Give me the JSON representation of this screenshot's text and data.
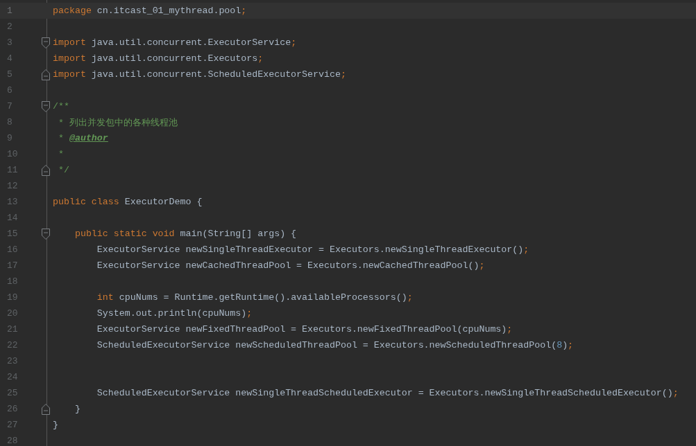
{
  "editor": {
    "lines": [
      {
        "number": "1",
        "current": true,
        "kind": "plain",
        "tokens": [
          {
            "kind": "keyword",
            "text": "package "
          },
          {
            "kind": "plain",
            "text": "cn.itcast_01_mythread.pool"
          },
          {
            "kind": "punct",
            "text": ";"
          }
        ]
      },
      {
        "number": "2",
        "current": false,
        "kind": "plain"
      },
      {
        "number": "3",
        "current": false,
        "kind": "fold_start",
        "tokens": [
          {
            "kind": "keyword",
            "text": "import "
          },
          {
            "kind": "plain",
            "text": "java.util.concurrent.ExecutorService"
          },
          {
            "kind": "punct",
            "text": ";"
          }
        ]
      },
      {
        "number": "4",
        "current": false,
        "kind": "plain",
        "tokens": [
          {
            "kind": "keyword",
            "text": "import "
          },
          {
            "kind": "plain",
            "text": "java.util.concurrent.Executors"
          },
          {
            "kind": "punct",
            "text": ";"
          }
        ]
      },
      {
        "number": "5",
        "current": false,
        "kind": "fold_end",
        "tokens": [
          {
            "kind": "keyword",
            "text": "import "
          },
          {
            "kind": "plain",
            "text": "java.util.concurrent.ScheduledExecutorService"
          },
          {
            "kind": "punct",
            "text": ";"
          }
        ]
      },
      {
        "number": "6",
        "current": false,
        "kind": "plain"
      },
      {
        "number": "7",
        "current": false,
        "kind": "fold_start",
        "tokens": [
          {
            "kind": "comment",
            "text": "/**"
          }
        ]
      },
      {
        "number": "8",
        "current": false,
        "kind": "plain",
        "tokens": [
          {
            "kind": "comment",
            "text": " * 列出并发包中的各种线程池"
          }
        ]
      },
      {
        "number": "9",
        "current": false,
        "kind": "plain",
        "tokens": [
          {
            "kind": "comment",
            "text": " * "
          },
          {
            "kind": "doctag",
            "text": "@author"
          }
        ]
      },
      {
        "number": "10",
        "current": false,
        "kind": "plain",
        "tokens": [
          {
            "kind": "comment",
            "text": " *"
          }
        ]
      },
      {
        "number": "11",
        "current": false,
        "kind": "fold_end",
        "tokens": [
          {
            "kind": "comment",
            "text": " */"
          }
        ]
      },
      {
        "number": "12",
        "current": false,
        "kind": "plain"
      },
      {
        "number": "13",
        "current": false,
        "kind": "plain",
        "tokens": [
          {
            "kind": "keyword",
            "text": "public class "
          },
          {
            "kind": "plain",
            "text": "ExecutorDemo {"
          }
        ]
      },
      {
        "number": "14",
        "current": false,
        "kind": "plain"
      },
      {
        "number": "15",
        "current": false,
        "kind": "fold_start",
        "tokens": [
          {
            "kind": "keyword",
            "text": "    public static void "
          },
          {
            "kind": "plain",
            "text": "main(String[] args) {"
          }
        ]
      },
      {
        "number": "16",
        "current": false,
        "kind": "plain",
        "tokens": [
          {
            "kind": "plain",
            "text": "        ExecutorService newSingleThreadExecutor = Executors.newSingleThreadExecutor()"
          },
          {
            "kind": "punct",
            "text": ";"
          }
        ]
      },
      {
        "number": "17",
        "current": false,
        "kind": "plain",
        "tokens": [
          {
            "kind": "plain",
            "text": "        ExecutorService newCachedThreadPool = Executors.newCachedThreadPool()"
          },
          {
            "kind": "punct",
            "text": ";"
          }
        ]
      },
      {
        "number": "18",
        "current": false,
        "kind": "plain"
      },
      {
        "number": "19",
        "current": false,
        "kind": "plain",
        "tokens": [
          {
            "kind": "keyword",
            "text": "        int "
          },
          {
            "kind": "plain",
            "text": "cpuNums = Runtime.getRuntime().availableProcessors()"
          },
          {
            "kind": "punct",
            "text": ";"
          }
        ]
      },
      {
        "number": "20",
        "current": false,
        "kind": "plain",
        "tokens": [
          {
            "kind": "plain",
            "text": "        System.out.println(cpuNums)"
          },
          {
            "kind": "punct",
            "text": ";"
          }
        ]
      },
      {
        "number": "21",
        "current": false,
        "kind": "plain",
        "tokens": [
          {
            "kind": "plain",
            "text": "        ExecutorService newFixedThreadPool = Executors.newFixedThreadPool(cpuNums)"
          },
          {
            "kind": "punct",
            "text": ";"
          }
        ]
      },
      {
        "number": "22",
        "current": false,
        "kind": "plain",
        "tokens": [
          {
            "kind": "plain",
            "text": "        ScheduledExecutorService newScheduledThreadPool = Executors.newScheduledThreadPool("
          },
          {
            "kind": "number",
            "text": "8"
          },
          {
            "kind": "plain",
            "text": ")"
          },
          {
            "kind": "punct",
            "text": ";"
          }
        ]
      },
      {
        "number": "23",
        "current": false,
        "kind": "plain"
      },
      {
        "number": "24",
        "current": false,
        "kind": "plain"
      },
      {
        "number": "25",
        "current": false,
        "kind": "plain",
        "tokens": [
          {
            "kind": "plain",
            "text": "        ScheduledExecutorService newSingleThreadScheduledExecutor = Executors.newSingleThreadScheduledExecutor()"
          },
          {
            "kind": "punct",
            "text": ";"
          }
        ]
      },
      {
        "number": "26",
        "current": false,
        "kind": "fold_end",
        "tokens": [
          {
            "kind": "plain",
            "text": "    }"
          }
        ]
      },
      {
        "number": "27",
        "current": false,
        "kind": "plain",
        "tokens": [
          {
            "kind": "plain",
            "text": "}"
          }
        ]
      },
      {
        "number": "28",
        "current": false,
        "kind": "plain"
      }
    ]
  }
}
